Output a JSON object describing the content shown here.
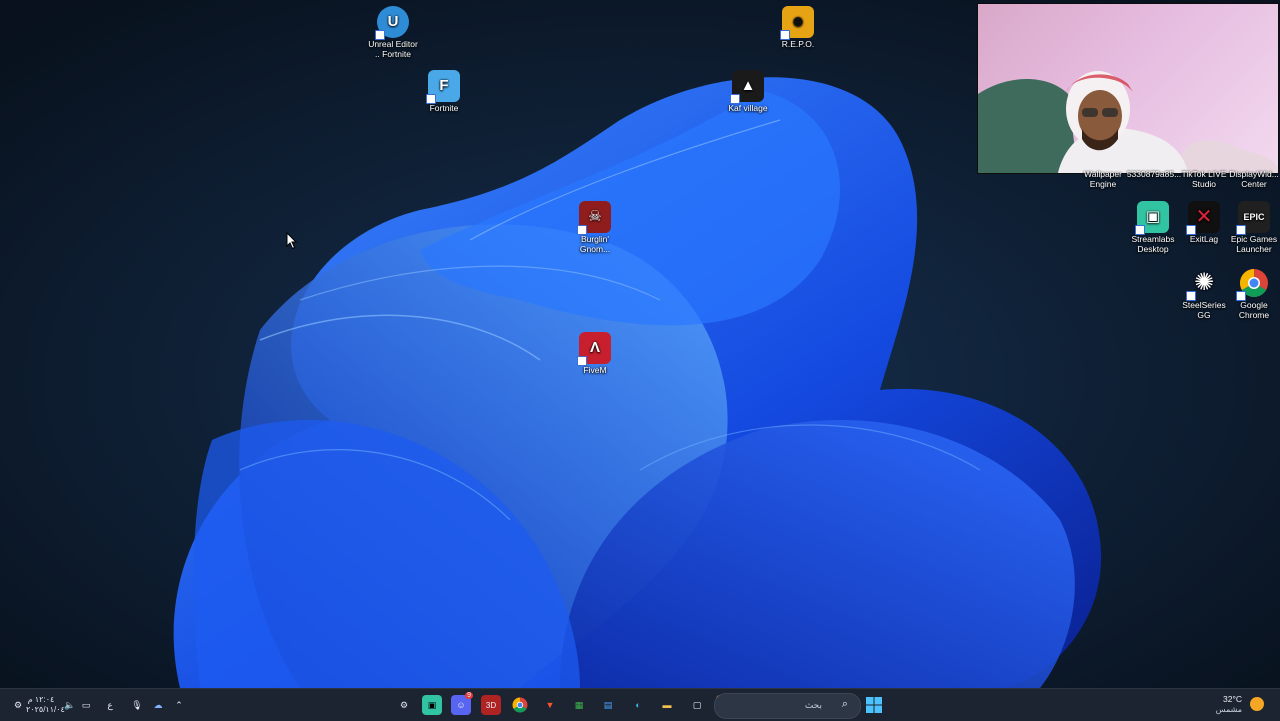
{
  "desktop": {
    "icons": [
      {
        "id": "unreal",
        "label": "Unreal Editor\n.. Fortnite",
        "color": "#2e8bd6",
        "glyph": "U"
      },
      {
        "id": "repo",
        "label": "R.E.P.O.",
        "color": "#1e1e1e",
        "glyph": "☻"
      },
      {
        "id": "fortnite",
        "label": "Fortnite",
        "color": "#4aa8e8",
        "glyph": "F"
      },
      {
        "id": "kafvillage",
        "label": "Kaf village",
        "color": "#1a1a1a",
        "glyph": "▲"
      },
      {
        "id": "burglin",
        "label": "Burglin'\nGnom...",
        "color": "#8f1d1d",
        "glyph": "☠"
      },
      {
        "id": "fivem",
        "label": "FiveM",
        "color": "#c71f2d",
        "glyph": "Λ"
      },
      {
        "id": "wallpaper",
        "label": "Wallpaper\nEngine",
        "color": "#2a3c5a",
        "glyph": "W"
      },
      {
        "id": "file",
        "label": "5330879a85...",
        "color": "#444",
        "glyph": ""
      },
      {
        "id": "tiktok",
        "label": "TikTok LIVE\nStudio",
        "color": "#111",
        "glyph": "♪"
      },
      {
        "id": "displaywid",
        "label": "DisplayWid...\nCenter",
        "color": "#333",
        "glyph": "D"
      },
      {
        "id": "streamlabs",
        "label": "Streamlabs\nDesktop",
        "color": "#31c3a2",
        "glyph": "▣"
      },
      {
        "id": "exitlag",
        "label": "ExitLag",
        "color": "#101010",
        "glyph": "✕"
      },
      {
        "id": "epic",
        "label": "Epic Games\nLauncher",
        "color": "#202020",
        "glyph": "EPIC"
      },
      {
        "id": "steelseries",
        "label": "SteelSeries\nGG",
        "color": "#1b1b1b",
        "glyph": "✺"
      },
      {
        "id": "chrome",
        "label": "Google\nChrome",
        "color": "#ffffff",
        "glyph": ""
      }
    ]
  },
  "taskbar": {
    "search_placeholder": "بحث",
    "clock_time": "١٢:٠٤ م",
    "clock_date": "٢٠٢٥/١١/٠٤",
    "weather_temp": "32°C",
    "weather_desc": "مشمس",
    "lang": "ع",
    "discord_badge": "9"
  },
  "colors": {
    "accent": "#1a73e8",
    "taskbar_bg": "#1c2431"
  }
}
